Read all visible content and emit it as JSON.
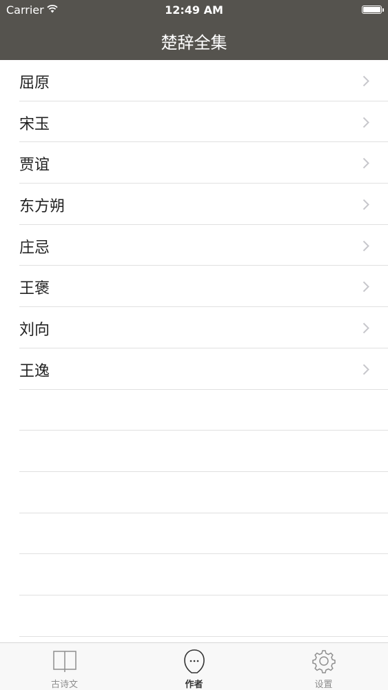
{
  "status_bar": {
    "carrier": "Carrier",
    "time": "12:49 AM",
    "battery_level": 1.0
  },
  "nav": {
    "title": "楚辞全集",
    "background_color": "#55534e"
  },
  "authors": [
    {
      "name": "屈原"
    },
    {
      "name": "宋玉"
    },
    {
      "name": "贾谊"
    },
    {
      "name": "东方朔"
    },
    {
      "name": "庄忌"
    },
    {
      "name": "王褒"
    },
    {
      "name": "刘向"
    },
    {
      "name": "王逸"
    }
  ],
  "tabs": [
    {
      "label": "古诗文",
      "icon": "book-icon",
      "active": false
    },
    {
      "label": "作者",
      "icon": "person-icon",
      "active": true
    },
    {
      "label": "设置",
      "icon": "gear-icon",
      "active": false
    }
  ]
}
